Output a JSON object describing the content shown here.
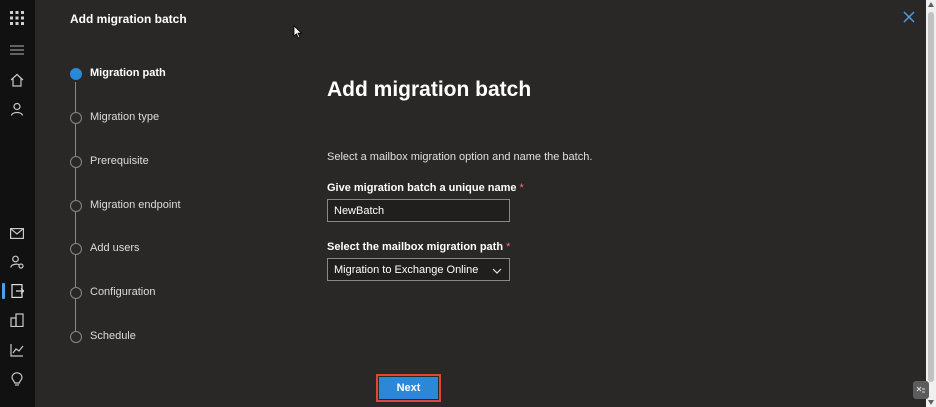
{
  "panel": {
    "header": "Add migration batch",
    "title": "Add migration batch",
    "description": "Select a mailbox migration option and name the batch."
  },
  "steps": [
    {
      "label": "Migration path",
      "current": true
    },
    {
      "label": "Migration type",
      "current": false
    },
    {
      "label": "Prerequisite",
      "current": false
    },
    {
      "label": "Migration endpoint",
      "current": false
    },
    {
      "label": "Add users",
      "current": false
    },
    {
      "label": "Configuration",
      "current": false
    },
    {
      "label": "Schedule",
      "current": false
    }
  ],
  "form": {
    "name_label": "Give migration batch a unique name",
    "name_value": "NewBatch",
    "path_label": "Select the mailbox migration path",
    "path_value": "Migration to Exchange Online",
    "required_mark": "*"
  },
  "actions": {
    "next_label": "Next"
  },
  "rail": {
    "icons": [
      "app-launcher-icon",
      "hamburger-menu-icon",
      "home-icon",
      "user-icon",
      "mail-icon",
      "user-settings-icon",
      "migration-icon",
      "buildings-icon",
      "chart-icon",
      "lightbulb-icon"
    ]
  },
  "colors": {
    "accent": "#2b88d8",
    "highlight_border": "#e0453c",
    "required": "#f1707b"
  }
}
